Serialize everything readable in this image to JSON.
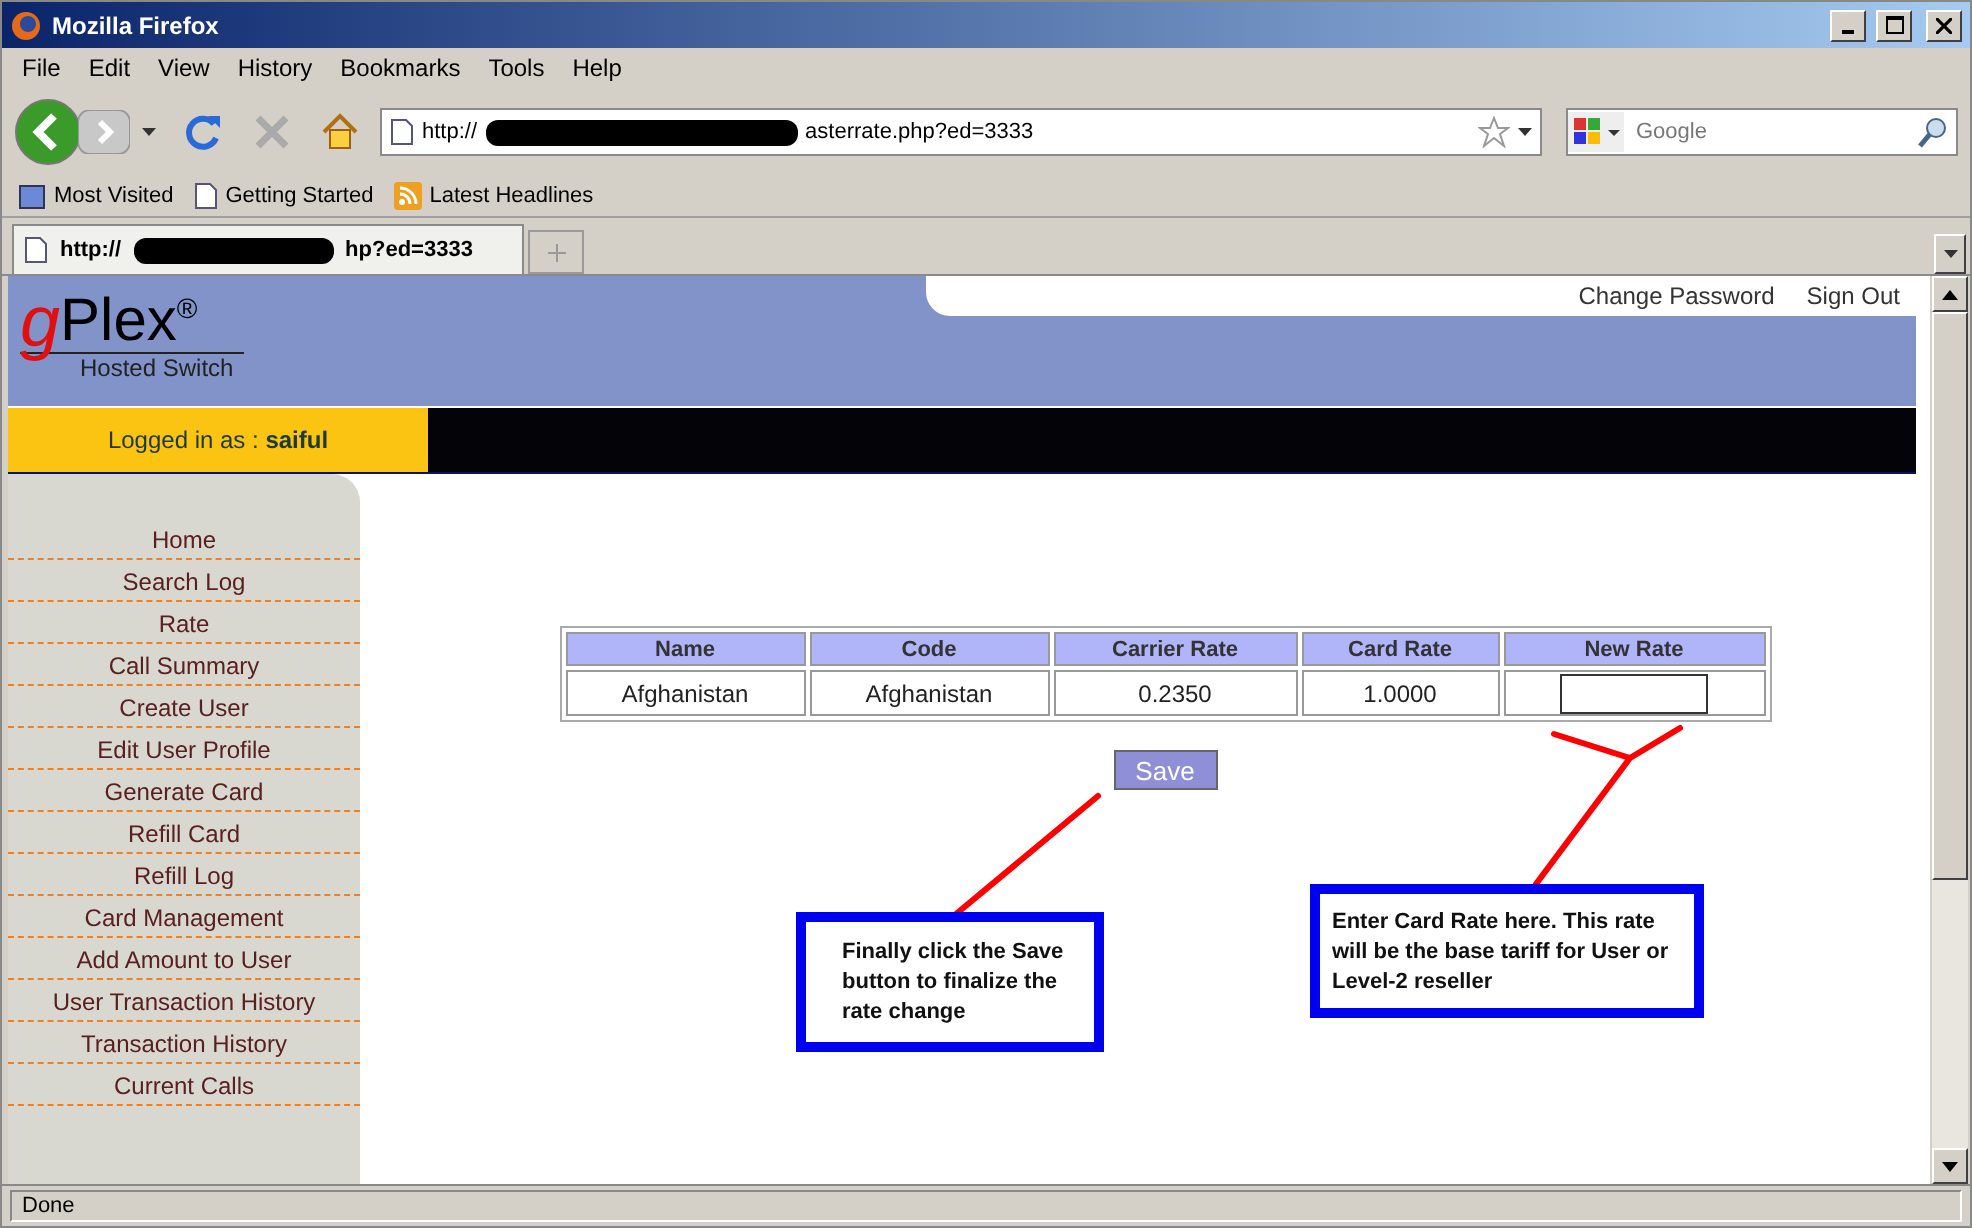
{
  "window": {
    "title": "Mozilla Firefox"
  },
  "menu": [
    "File",
    "Edit",
    "View",
    "History",
    "Bookmarks",
    "Tools",
    "Help"
  ],
  "address_bar": {
    "prefix": "http://",
    "suffix": "asterrate.php?ed=3333"
  },
  "search": {
    "placeholder": "Google"
  },
  "bookmarks": [
    {
      "kind": "folder",
      "label": "Most Visited"
    },
    {
      "kind": "page",
      "label": "Getting Started"
    },
    {
      "kind": "feed",
      "label": "Latest Headlines"
    }
  ],
  "tabs": [
    {
      "prefix": "http://",
      "suffix": "hp?ed=3333",
      "selected": true
    }
  ],
  "page": {
    "logo": {
      "mark": "g",
      "name": "Plex",
      "registered": "®",
      "tagline": "Hosted Switch"
    },
    "header_links": [
      "Change Password",
      "Sign Out"
    ],
    "login": "Logged in as : **saiful**",
    "nav": [
      "Home",
      "Search Log",
      "Rate",
      "Call Summary",
      "Create User",
      "Edit User Profile",
      "Generate Card",
      "Refill Card",
      "Refill Log",
      "Card Management",
      "Add Amount to User",
      "User Transaction History",
      "Transaction History",
      "Current Calls"
    ],
    "table": {
      "columns": [
        "Name",
        "Code",
        "Carrier Rate",
        "Card Rate",
        "New Rate"
      ],
      "rows": [
        {
          "cells": [
            "Afghanistan",
            "Afghanistan",
            "0.2350",
            "1.0000"
          ]
        }
      ]
    },
    "save_button": "Save",
    "annotations": [
      "Finally click the Save button to finalize the rate change",
      "Enter Card Rate here. This rate will be the base tariff for User or Level-2 reseller"
    ]
  },
  "status_bar": "Done"
}
